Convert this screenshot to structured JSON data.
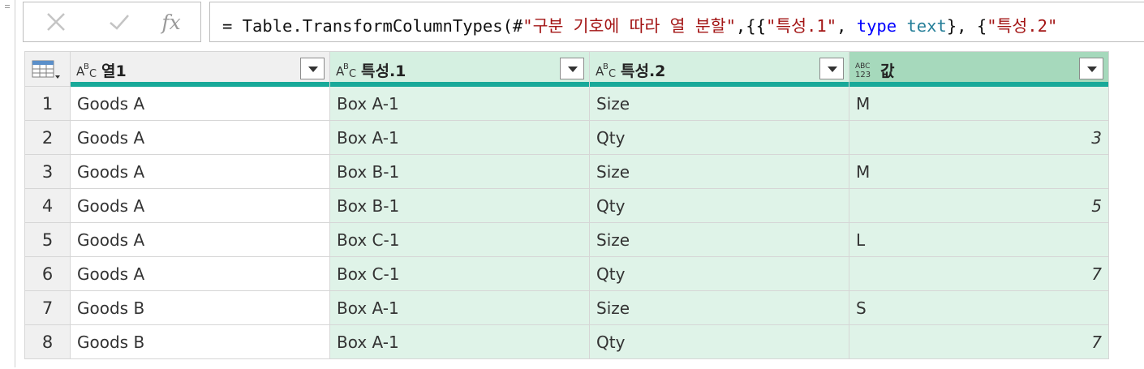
{
  "formula_bar": {
    "cancel_icon": "close-icon",
    "commit_icon": "check-icon",
    "fx_label": "fx",
    "parts": [
      {
        "t": "= Table.TransformColumnTypes(#",
        "c": ""
      },
      {
        "t": "\"구분 기호에 따라 열 분할\"",
        "c": "f-str"
      },
      {
        "t": ",{{",
        "c": ""
      },
      {
        "t": "\"특성.1\"",
        "c": "f-str"
      },
      {
        "t": ", ",
        "c": ""
      },
      {
        "t": "type",
        "c": "f-kw"
      },
      {
        "t": " ",
        "c": ""
      },
      {
        "t": "text",
        "c": "f-type"
      },
      {
        "t": "}, {",
        "c": ""
      },
      {
        "t": "\"특성.2\"",
        "c": "f-str"
      }
    ]
  },
  "grid": {
    "corner_icon": "table-menu-icon",
    "columns": [
      {
        "label": "열1",
        "type": "ABC",
        "style": "plain"
      },
      {
        "label": "특성.1",
        "type": "ABC",
        "style": "sel"
      },
      {
        "label": "특성.2",
        "type": "ABC",
        "style": "sel"
      },
      {
        "label": "값",
        "type": "ABC123",
        "style": "sel2"
      }
    ],
    "rows": [
      {
        "n": "1",
        "c": [
          "Goods A",
          "Box A-1",
          "Size",
          "M"
        ]
      },
      {
        "n": "2",
        "c": [
          "Goods A",
          "Box A-1",
          "Qty",
          "3"
        ]
      },
      {
        "n": "3",
        "c": [
          "Goods A",
          "Box B-1",
          "Size",
          "M"
        ]
      },
      {
        "n": "4",
        "c": [
          "Goods A",
          "Box B-1",
          "Qty",
          "5"
        ]
      },
      {
        "n": "5",
        "c": [
          "Goods A",
          "Box C-1",
          "Size",
          "L"
        ]
      },
      {
        "n": "6",
        "c": [
          "Goods A",
          "Box C-1",
          "Qty",
          "7"
        ]
      },
      {
        "n": "7",
        "c": [
          "Goods B",
          "Box A-1",
          "Size",
          "S"
        ]
      },
      {
        "n": "8",
        "c": [
          "Goods B",
          "Box A-1",
          "Qty",
          "7"
        ]
      }
    ]
  },
  "colors": {
    "accent_bar": "#18a999",
    "selected_col": "#dff3e8",
    "selected_header": "#a6d9bc"
  }
}
